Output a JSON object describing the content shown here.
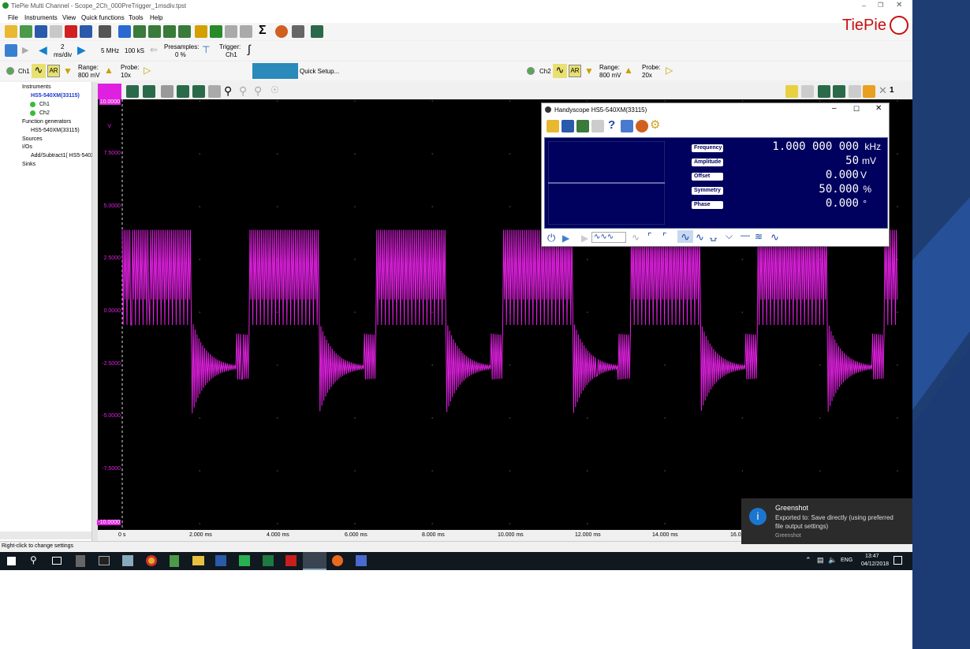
{
  "window": {
    "title": "TiePie Multi Channel - Scope_2Ch_000PreTrigger_1msdiv.tpst"
  },
  "menu": [
    "File",
    "Instruments",
    "View",
    "Quick functions",
    "Tools",
    "Help"
  ],
  "brand": {
    "logo_text": "TiePie"
  },
  "timebase": {
    "value": "2",
    "unit": "ms/div",
    "sample_rate": "5 MHz",
    "record_length": "100 kS",
    "presamples_label": "Presamples:",
    "presamples_value": "0 %",
    "trigger_label": "Trigger:",
    "trigger_value": "Ch1"
  },
  "ch1": {
    "name": "Ch1",
    "range_label": "Range:",
    "range_value": "800 mV",
    "probe_label": "Probe:",
    "probe_value": "10x"
  },
  "ch2": {
    "name": "Ch2",
    "range_label": "Range:",
    "range_value": "800 mV",
    "probe_label": "Probe:",
    "probe_value": "20x"
  },
  "quick_setup": "Quick Setup...",
  "tree": {
    "instruments": "Instruments",
    "device": "HS5-540XM(33115)",
    "ch1": "Ch1",
    "ch2": "Ch2",
    "function_generators": "Function generators",
    "fg_device": "HS5-540XM(33115)",
    "sources": "Sources",
    "ios": "I/Os",
    "io_item": "Add/Subtract1( HS5-540X",
    "sinks": "Sinks"
  },
  "status_text": "Right-click to change settings",
  "y_axis": {
    "unit": "V",
    "ticks": [
      "10.0000",
      "7.5000",
      "5.0000",
      "2.5000",
      "0.0000",
      "-2.5000",
      "-5.0000",
      "-7.5000",
      "-10.0000"
    ]
  },
  "x_axis": {
    "ticks": [
      "0 s",
      "2.000 ms",
      "4.000 ms",
      "6.000 ms",
      "8.000 ms",
      "10.000 ms",
      "12.000 ms",
      "14.000 ms",
      "16.0"
    ]
  },
  "fg_window": {
    "title": "Handyscope HS5-540XM(33115)",
    "params": [
      {
        "label": "Frequency",
        "value": "1.000 000 000",
        "unit": "kHz"
      },
      {
        "label": "Amplitude",
        "value": "50",
        "unit": "mV"
      },
      {
        "label": "Offset",
        "value": "0.000",
        "unit": "V"
      },
      {
        "label": "Symmetry",
        "value": "50.000",
        "unit": "%"
      },
      {
        "label": "Phase",
        "value": "0.000",
        "unit": "°"
      }
    ]
  },
  "toast": {
    "title": "Greenshot",
    "body": "Exported to: Save directly (using preferred file output settings)",
    "footer": "Greenshot"
  },
  "tray": {
    "lang": "ENG",
    "time": "13:47",
    "date": "04/12/2018"
  },
  "colors": {
    "trace": "#e020e0",
    "scope_bg": "#000000",
    "lcd_bg": "#00005e"
  }
}
